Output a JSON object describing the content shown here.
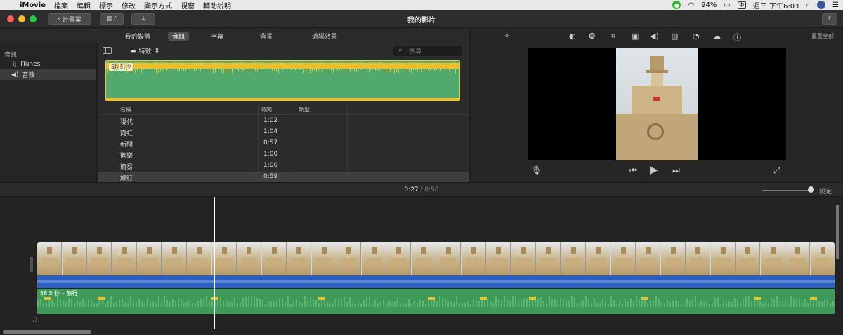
{
  "menubar": {
    "app": "iMovie",
    "items": [
      "檔案",
      "編輯",
      "標示",
      "修改",
      "顯示方式",
      "視窗",
      "輔助說明"
    ],
    "battery": "94%",
    "clock": "週三 下午6:03"
  },
  "titlebar": {
    "back_label": "計畫案",
    "title": "我的影片"
  },
  "tabs": [
    "我的媒體",
    "音訊",
    "字幕",
    "背景",
    "過場效果"
  ],
  "sidebar": {
    "title": "音訊",
    "items": [
      {
        "label": "iTunes"
      },
      {
        "label": "音效"
      }
    ]
  },
  "browser": {
    "folder": "特效",
    "search_placeholder": "搜尋",
    "waveform_duration": "58.5 秒",
    "columns": [
      "名稱",
      "時間",
      "類型"
    ],
    "rows": [
      {
        "name": "現代",
        "time": "1:02"
      },
      {
        "name": "霓虹",
        "time": "1:04"
      },
      {
        "name": "新聞",
        "time": "0:57"
      },
      {
        "name": "歡樂",
        "time": "1:00"
      },
      {
        "name": "簡易",
        "time": "1:00"
      },
      {
        "name": "旅行",
        "time": "0:59"
      }
    ]
  },
  "viewer": {
    "reset_all": "重置全部"
  },
  "timeline": {
    "current_time": "0:27",
    "separator": "/",
    "total_time": "0:58",
    "settings": "設定",
    "music_clip_label": "58.5 秒 – 旅行"
  },
  "colors": {
    "music_clip": "#3f9a5a",
    "audio_clip": "#2c5fbf",
    "waveform_yellow": "#e8bf2f"
  }
}
